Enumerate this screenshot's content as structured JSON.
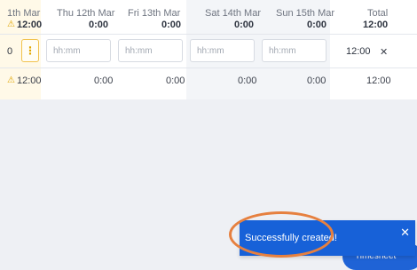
{
  "header": {
    "days": [
      {
        "label": "1th Mar",
        "total": "12:00",
        "warning": true
      },
      {
        "label": "Thu 12th Mar",
        "total": "0:00"
      },
      {
        "label": "Fri 13th Mar",
        "total": "0:00"
      },
      {
        "label": "Sat 14th Mar",
        "total": "0:00"
      },
      {
        "label": "Sun 15th Mar",
        "total": "0:00"
      }
    ],
    "total_label": "Total",
    "total_value": "12:00"
  },
  "entry_row": {
    "first_value": "0",
    "menu_icon": "kebab-menu-icon",
    "placeholder": "hh:mm",
    "total": "12:00",
    "close_icon": "close-icon"
  },
  "footer_row": {
    "first_value": "12:00",
    "values": [
      "0:00",
      "0:00",
      "0:00",
      "0:00"
    ],
    "total": "12:00"
  },
  "toast": {
    "message": "Successfully created!",
    "close_icon": "close-icon",
    "behind_button_label": "Timesheet"
  },
  "colors": {
    "weekday_highlight": "#fff9e8",
    "weekend_bg": "#f3f5f8",
    "warning": "#e0a500",
    "toast_bg": "#1761d8",
    "annotation": "#e6803f"
  }
}
